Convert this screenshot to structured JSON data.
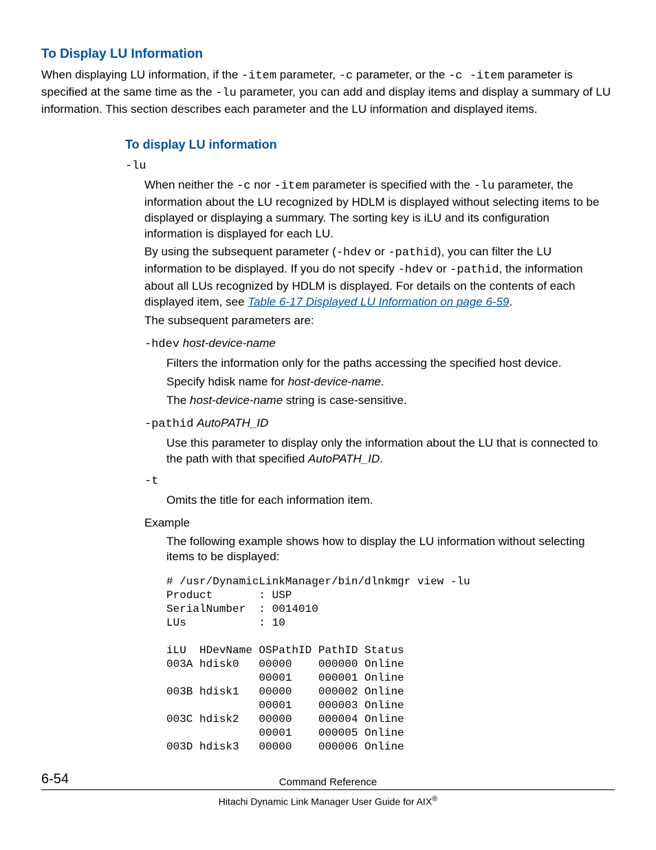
{
  "headings": {
    "main": "To Display LU Information",
    "sub": "To display LU information"
  },
  "intro": {
    "t1": "When displaying LU information, if the ",
    "c1": "-item",
    "t2": " parameter, ",
    "c2": "-c",
    "t3": " parameter, or the ",
    "c3": "-c -item",
    "t4": " parameter is specified at the same time as the ",
    "c4": "-lu",
    "t5": " parameter, you can add and display items and display a summary of LU information. This section describes each parameter and the LU information and displayed items."
  },
  "lu": {
    "flag": "-lu",
    "p1a": "When neither the ",
    "p1c1": "-c",
    "p1b": " nor ",
    "p1c2": "-item",
    "p1c": " parameter is specified with the ",
    "p1c3": "-lu",
    "p1d": " parameter, the information about the LU recognized by HDLM is displayed without selecting items to be displayed or displaying a summary. The sorting key is iLU and its configuration information is displayed for each LU.",
    "p2a": "By using the subsequent parameter (",
    "p2c1": "-hdev",
    "p2b": " or ",
    "p2c2": "-pathid",
    "p2c": "), you can filter the LU information to be displayed. If you do not specify ",
    "p2c3": "-hdev",
    "p2d": " or ",
    "p2c4": "-pathid",
    "p2e": ", the information about all LUs recognized by HDLM is displayed. For details on the contents of each displayed item, see ",
    "link": "Table 6-17 Displayed LU Information on page 6-59",
    "p2f": ".",
    "p3": "The subsequent parameters are:"
  },
  "hdev": {
    "flag": "-hdev",
    "arg": "host-device-name",
    "l1": "Filters the information only for the paths accessing the specified host device.",
    "l2a": "Specify hdisk name for ",
    "l2i": "host-device-name",
    "l2b": ".",
    "l3a": "The ",
    "l3i": "host-device-name",
    "l3b": " string is case-sensitive."
  },
  "pathid": {
    "flag": "-pathid",
    "arg": "AutoPATH_ID",
    "l1a": "Use this parameter to display only the information about the LU that is connected to the path with that specified ",
    "l1i": "AutoPATH_ID",
    "l1b": "."
  },
  "tflag": {
    "flag": "-t",
    "l1": "Omits the title for each information item."
  },
  "example": {
    "label": "Example",
    "desc": "The following example shows how to display the LU information without selecting items to be displayed:",
    "code": "# /usr/DynamicLinkManager/bin/dlnkmgr view -lu\nProduct       : USP\nSerialNumber  : 0014010\nLUs           : 10\n\niLU  HDevName OSPathID PathID Status\n003A hdisk0   00000    000000 Online\n              00001    000001 Online\n003B hdisk1   00000    000002 Online\n              00001    000003 Online\n003C hdisk2   00000    000004 Online\n              00001    000005 Online\n003D hdisk3   00000    000006 Online"
  },
  "footer": {
    "page": "6-54",
    "section": "Command Reference",
    "doc_a": "Hitachi Dynamic Link Manager User Guide for AIX",
    "doc_reg": "®"
  }
}
